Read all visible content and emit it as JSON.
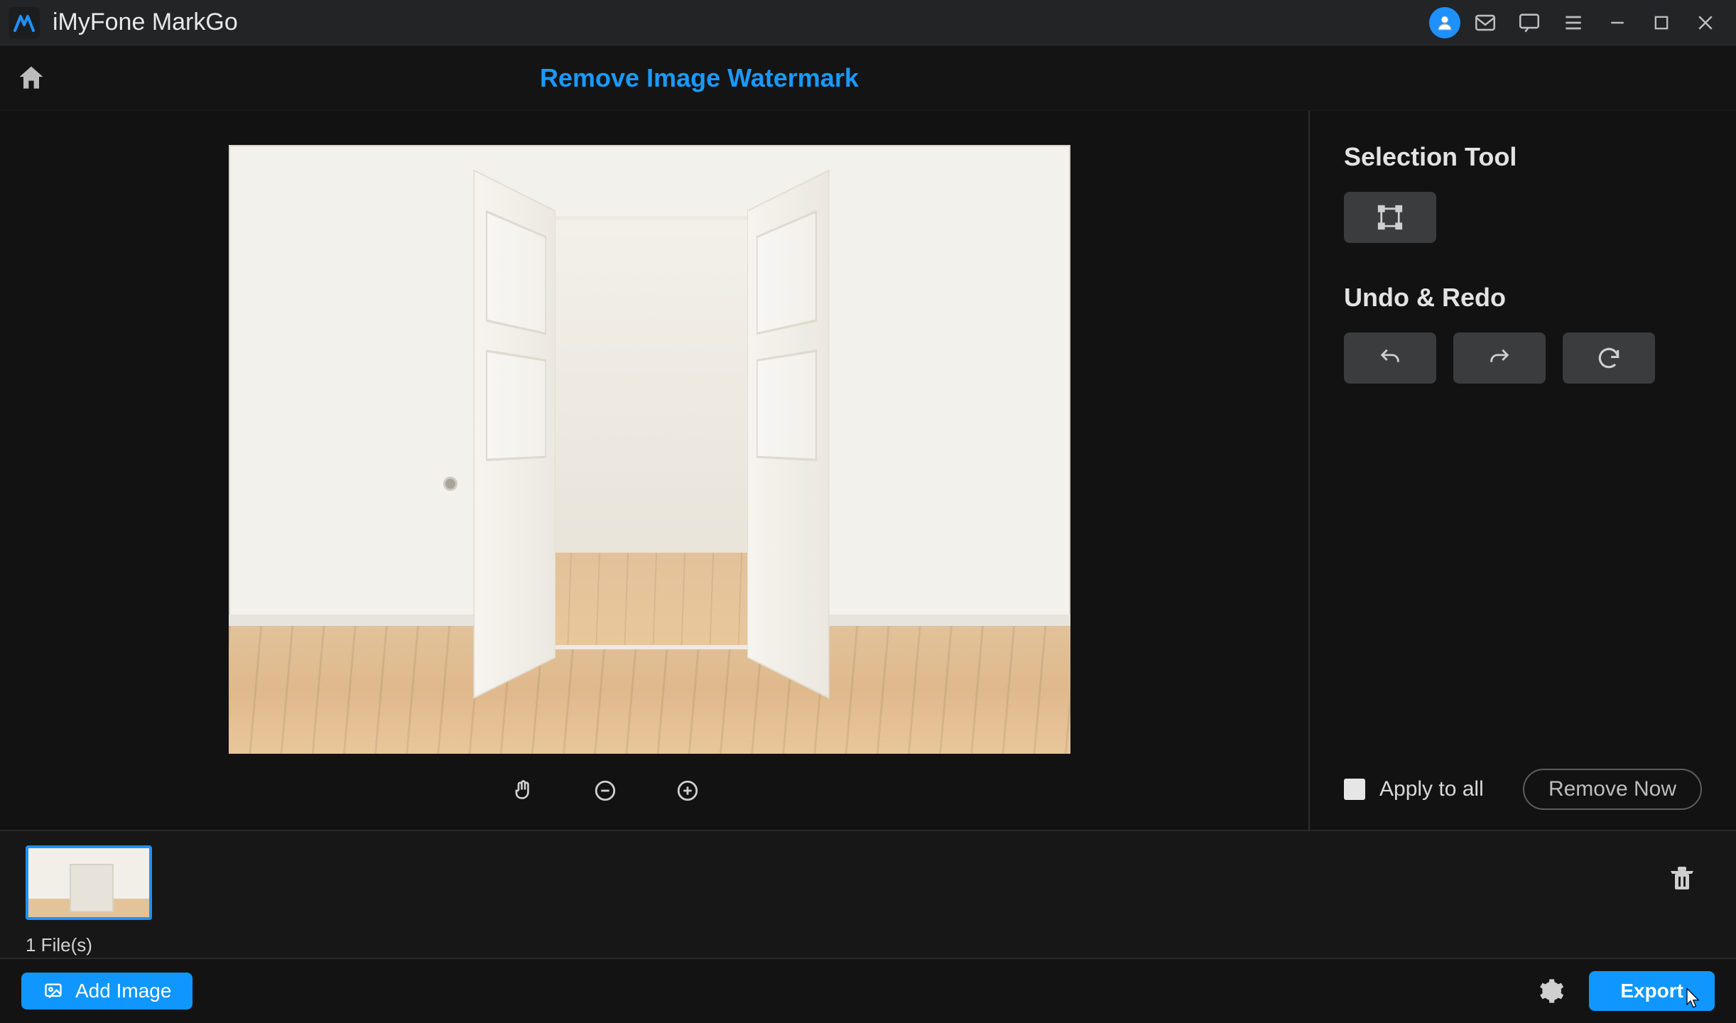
{
  "app": {
    "title": "iMyFone MarkGo"
  },
  "header": {
    "page_title": "Remove Image Watermark"
  },
  "sidepanel": {
    "selection_tool_label": "Selection Tool",
    "undo_redo_label": "Undo & Redo",
    "apply_to_all_label": "Apply to all",
    "remove_now_label": "Remove Now"
  },
  "filmstrip": {
    "file_count_label": "1 File(s)"
  },
  "bottombar": {
    "add_image_label": "Add Image",
    "export_label": "Export"
  },
  "colors": {
    "accent": "#1e90ff",
    "accent_bright": "#0f97ff"
  },
  "icons": {
    "user": "user-icon",
    "mail": "mail-icon",
    "message": "message-icon",
    "menu": "menu-icon",
    "minimize": "minimize-icon",
    "maximize": "maximize-icon",
    "close": "close-icon",
    "home": "home-icon",
    "selection-rect": "selection-rect-icon",
    "undo": "undo-icon",
    "redo": "redo-icon",
    "reset": "reset-icon",
    "pan": "pan-hand-icon",
    "zoom_out": "zoom-out-icon",
    "zoom_in": "zoom-in-icon",
    "trash": "trash-icon",
    "gear": "gear-icon",
    "image": "image-icon"
  }
}
